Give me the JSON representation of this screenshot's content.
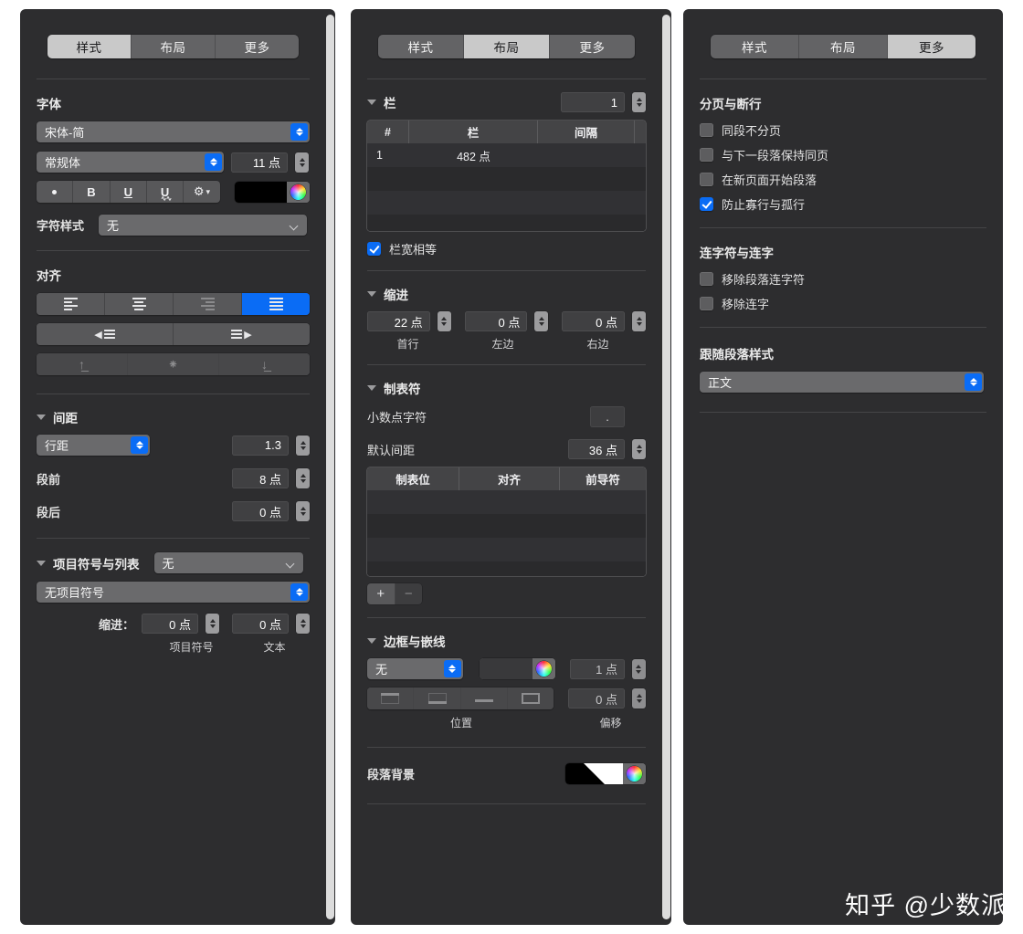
{
  "tabs": {
    "style": "样式",
    "layout": "布局",
    "more": "更多"
  },
  "panels": {
    "style": {
      "active_tab": "样式",
      "font": {
        "heading": "字体",
        "family": "宋体-简",
        "weight": "常规体",
        "size": "11 点",
        "style_buttons": [
          "bullet",
          "B",
          "U",
          "U-wavy",
          "gear"
        ],
        "color": "#000000",
        "char_style_label": "字符样式",
        "char_style_value": "无"
      },
      "align": {
        "heading": "对齐",
        "horizontal": [
          "left",
          "center",
          "right",
          "justify"
        ],
        "horizontal_selected": "justify",
        "indent_buttons": [
          "decrease-indent",
          "increase-indent"
        ],
        "vertical": [
          "top",
          "middle",
          "bottom"
        ]
      },
      "spacing": {
        "heading": "间距",
        "mode": "行距",
        "line_value": "1.3",
        "before_label": "段前",
        "before_value": "8 点",
        "after_label": "段后",
        "after_value": "0 点"
      },
      "bullets": {
        "heading": "项目符号与列表",
        "preset": "无",
        "type": "无项目符号",
        "indent_label": "缩进：",
        "bullet_indent": "0 点",
        "text_indent": "0 点",
        "bullet_sublabel": "项目符号",
        "text_sublabel": "文本"
      }
    },
    "layout": {
      "active_tab": "布局",
      "columns": {
        "heading": "栏",
        "count": "1",
        "table_headers": [
          "#",
          "栏",
          "间隔"
        ],
        "rows": [
          [
            "1",
            "482 点",
            ""
          ]
        ],
        "equal_width_label": "栏宽相等",
        "equal_width_checked": true
      },
      "indents": {
        "heading": "缩进",
        "first_line_value": "22 点",
        "first_line_label": "首行",
        "left_value": "0 点",
        "left_label": "左边",
        "right_value": "0 点",
        "right_label": "右边"
      },
      "tabs_section": {
        "heading": "制表符",
        "decimal_label": "小数点字符",
        "decimal_value": ".",
        "default_spacing_label": "默认间距",
        "default_spacing_value": "36 点",
        "table_headers": [
          "制表位",
          "对齐",
          "前导符"
        ],
        "rows": [],
        "add_label": "+",
        "remove_label": "−"
      },
      "borders": {
        "heading": "边框与嵌线",
        "style": "无",
        "color": "#39393b",
        "width": "1 点",
        "position_buttons": [
          "top",
          "bottom",
          "underline",
          "box"
        ],
        "position_label": "位置",
        "offset_value": "0 点",
        "offset_label": "偏移"
      },
      "background": {
        "label": "段落背景",
        "color": "gradient"
      }
    },
    "more": {
      "active_tab": "更多",
      "pagination": {
        "heading": "分页与断行",
        "items": [
          {
            "label": "同段不分页",
            "checked": false
          },
          {
            "label": "与下一段落保持同页",
            "checked": false
          },
          {
            "label": "在新页面开始段落",
            "checked": false
          },
          {
            "label": "防止寡行与孤行",
            "checked": true
          }
        ]
      },
      "ligatures": {
        "heading": "连字符与连字",
        "items": [
          {
            "label": "移除段落连字符",
            "checked": false
          },
          {
            "label": "移除连字",
            "checked": false
          }
        ]
      },
      "following": {
        "heading": "跟随段落样式",
        "value": "正文"
      }
    }
  },
  "watermark": "知乎 @少数派",
  "colors": {
    "accent": "#0a6cf5",
    "panel_bg": "#2d2d2f",
    "page_bg": "#ffffff"
  }
}
